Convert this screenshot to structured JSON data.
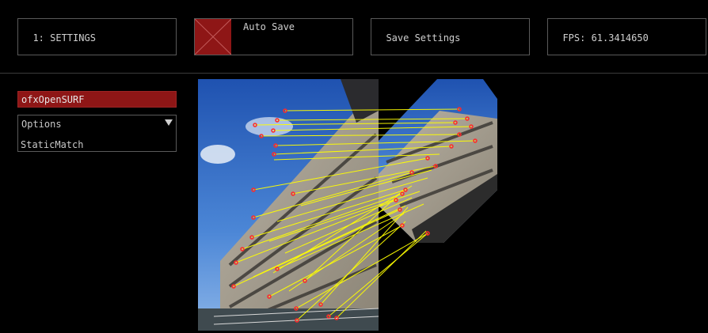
{
  "toolbar": {
    "settings_label": "1: SETTINGS",
    "auto_save_label": "Auto Save",
    "save_settings_label": "Save Settings",
    "fps_label": "FPS: 61.3414650"
  },
  "panel": {
    "header": "ofxOpenSURF",
    "options": {
      "label": "Options",
      "selected": "StaticMatch"
    }
  },
  "colors": {
    "accent": "#8e1616",
    "match_line": "#ffff00",
    "keypoint": "#ff2a2a"
  },
  "viewer": {
    "icons": [
      "building-photo",
      "rotated-building-photo",
      "match-lines",
      "keypoint-markers"
    ]
  }
}
